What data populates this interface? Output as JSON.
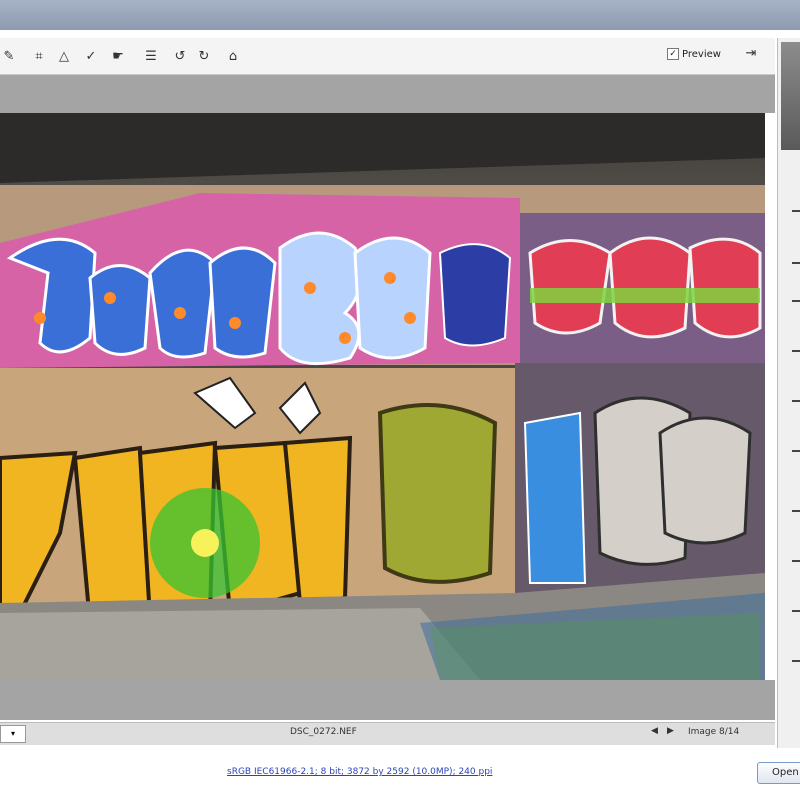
{
  "toolbar": {
    "tools": [
      {
        "name": "white-balance-tool-icon",
        "glyph": "✎"
      },
      {
        "name": "crop-tool-icon",
        "glyph": "⌗"
      },
      {
        "name": "straighten-tool-icon",
        "glyph": "△"
      },
      {
        "name": "spot-removal-tool-icon",
        "glyph": "✓"
      },
      {
        "name": "red-eye-tool-icon",
        "glyph": "☛"
      },
      {
        "name": "preferences-icon",
        "glyph": "☰"
      },
      {
        "name": "rotate-ccw-icon",
        "glyph": "↺"
      },
      {
        "name": "rotate-cw-icon",
        "glyph": "↻"
      },
      {
        "name": "trash-icon",
        "glyph": "⌂"
      }
    ],
    "preview_label": "Preview",
    "preview_checked": true
  },
  "status": {
    "filename": "DSC_0272.NEF",
    "image_counter": "Image 8/14"
  },
  "workflow_options": "sRGB IEC61966-2.1; 8 bit; 3872 by 2592 (10.0MP); 240 ppi",
  "buttons": {
    "open_label": "Open"
  },
  "colors": {
    "band_gray": "#a4a4a4",
    "link_blue": "#2a45b5"
  }
}
